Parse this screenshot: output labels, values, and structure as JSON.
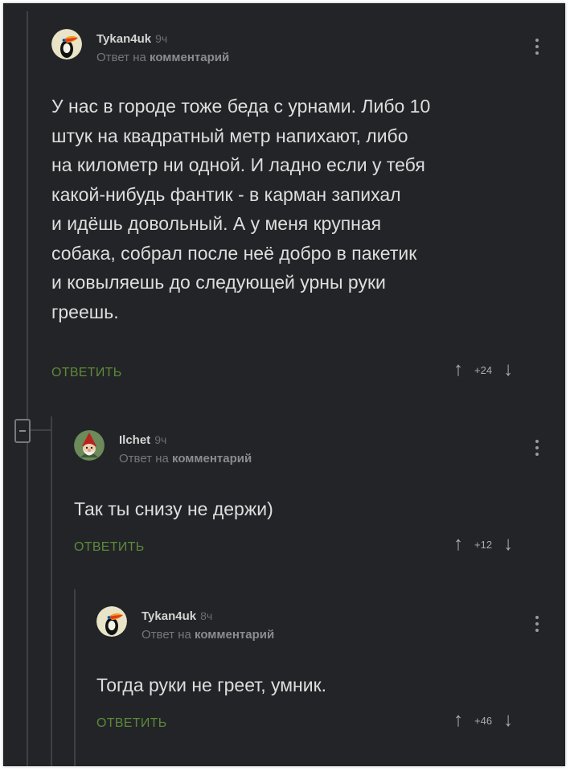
{
  "comments": [
    {
      "username": "Tykan4uk",
      "time": "9ч",
      "reply_prefix": "Ответ на",
      "reply_target": "комментарий",
      "text": "У нас в городе тоже беда с урнами. Либо 10\nштук на квадратный метр напихают, либо\nна километр ни одной. И ладно если у тебя\nкакой-нибудь фантик - в карман запихал\nи идёшь довольный. А у меня крупная\nсобака, собрал после неё добро в пакетик\nи ковыляешь до следующей урны руки\nгреешь.",
      "reply_label": "ОТВЕТИТЬ",
      "rating": "+24",
      "avatar_icon": "toucan-avatar-icon"
    },
    {
      "username": "Ilchet",
      "time": "9ч",
      "reply_prefix": "Ответ на",
      "reply_target": "комментарий",
      "text": "Так ты снизу не держи)",
      "reply_label": "ОТВЕТИТЬ",
      "rating": "+12",
      "avatar_icon": "gnome-avatar-icon"
    },
    {
      "username": "Tykan4uk",
      "time": "8ч",
      "reply_prefix": "Ответ на",
      "reply_target": "комментарий",
      "text": "Тогда руки не греет, умник.",
      "reply_label": "ОТВЕТИТЬ",
      "rating": "+46",
      "avatar_icon": "toucan-avatar-icon"
    }
  ],
  "vote_up_icon": "↑",
  "vote_down_icon": "↓",
  "colors": {
    "background": "#232427",
    "text": "#dedede",
    "reply_button": "#5c8a3a",
    "meta": "#75777b"
  }
}
